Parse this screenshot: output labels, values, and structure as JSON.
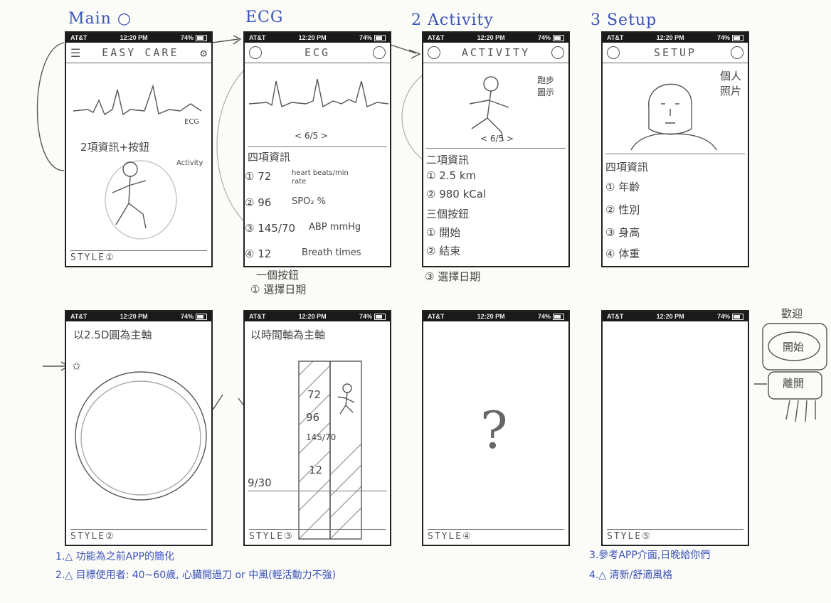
{
  "labels": {
    "main": "Main ○",
    "ecg": "ECG",
    "activity": "2 Activity",
    "setup": "3 Setup"
  },
  "status": {
    "carrier": "AT&T",
    "time": "12:20 PM",
    "battery": "74%"
  },
  "screen1": {
    "title": "EASY CARE",
    "info": "2項資訊+按鈕",
    "tag_ecg": "ECG",
    "tag_activity": "Activity",
    "style": "STYLE①"
  },
  "screen2": {
    "title": "ECG",
    "pager": "< 6/5 >",
    "section": "四項資訊",
    "rows": [
      {
        "num": "① 72",
        "desc": "heart beats/min",
        "sub": "rate"
      },
      {
        "num": "② 96",
        "desc": "SPO₂ %"
      },
      {
        "num": "③ 145/70",
        "desc": "ABP mmHg"
      },
      {
        "num": "④ 12",
        "desc": "Breath times"
      }
    ],
    "btn_section": "一個按鈕",
    "btn": "① 選擇日期"
  },
  "screen3": {
    "title": "ACTIVITY",
    "side_note": "跑步 圖示",
    "pager": "< 6/5 >",
    "section": "二項資訊",
    "rows": [
      "① 2.5 km",
      "② 980 kCal"
    ],
    "btn_section": "三個按鈕",
    "btns": [
      "① 開始",
      "② 結束",
      "③ 選擇日期"
    ]
  },
  "screen4": {
    "title": "SETUP",
    "side_note": "個人 照片",
    "section": "四項資訊",
    "rows": [
      "① 年齡",
      "② 性別",
      "③ 身高",
      "④ 体重"
    ]
  },
  "screen5": {
    "title": "以2.5D圓為主軸",
    "style": "STYLE②"
  },
  "screen6": {
    "title": "以時間軸為主軸",
    "values": [
      "72",
      "96",
      "145/70",
      "12"
    ],
    "date": "9/30",
    "style": "STYLE③"
  },
  "screen7": {
    "mark": "?",
    "style": "STYLE④"
  },
  "screen8": {
    "style": "STYLE⑤"
  },
  "side_panel": {
    "heading": "歡迎",
    "b1": "開始",
    "b2": "離開"
  },
  "notes": {
    "n1": "1.△ 功能為之前APP的簡化",
    "n2": "2.△ 目標使用者: 40~60歲, 心臟開過刀 or 中風(輕活動力不強)",
    "n3": "3.參考APP介面,日晚給你們",
    "n4": "4.△ 清新/舒適風格"
  }
}
